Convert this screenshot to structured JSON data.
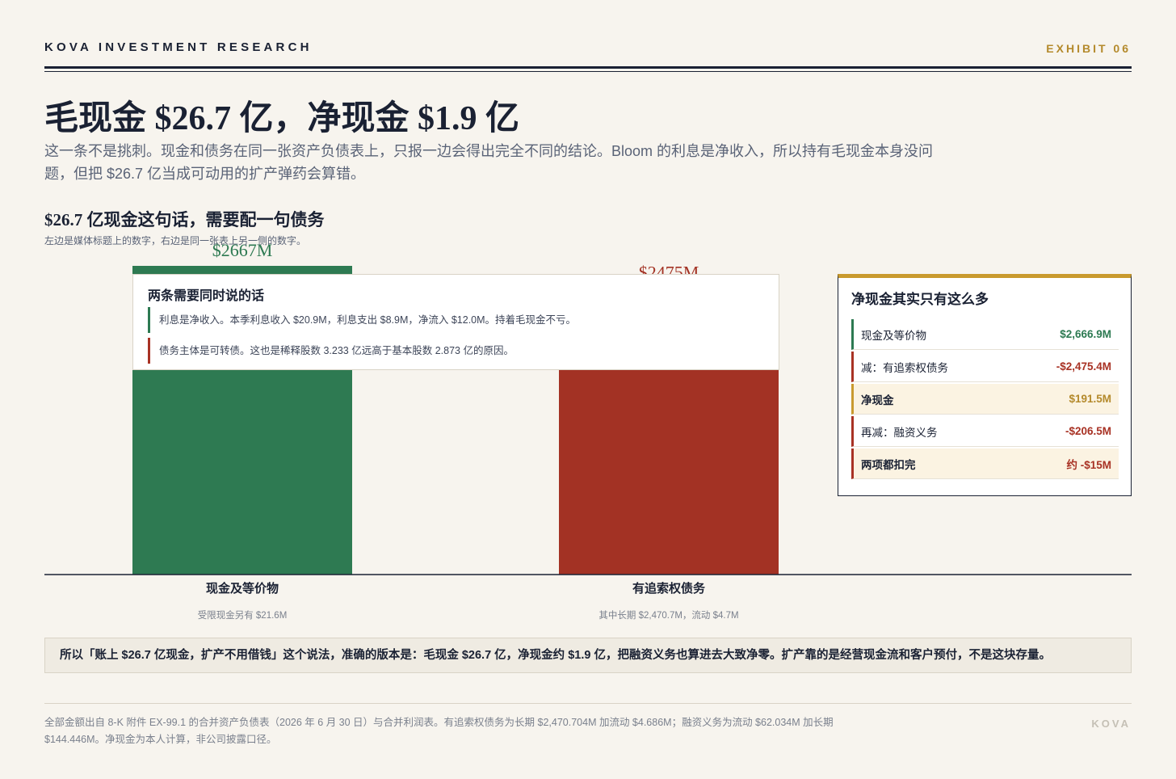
{
  "header": {
    "brand": "KOVA INVESTMENT RESEARCH",
    "exhibit": "EXHIBIT 06"
  },
  "headline": "毛现金 $26.7 亿，净现金 $1.9 亿",
  "subtitle": "这一条不是挑刺。现金和债务在同一张资产负债表上，只报一边会得出完全不同的结论。Bloom 的利息是净收入，所以持有毛现金本身没问题，但把 $26.7 亿当成可动用的扩产弹药会算错。",
  "chart_data": {
    "type": "bar",
    "title": "$26.7 亿现金这句话，需要配一句债务",
    "subtitle": "左边是媒体标题上的数字，右边是同一张表上另一侧的数字。",
    "categories": [
      "现金及等价物",
      "有追索权债务"
    ],
    "values": [
      2667,
      2475
    ],
    "value_labels": [
      "$2667M",
      "$2475M"
    ],
    "notes": [
      "受限现金另有 $21.6M",
      "其中长期 $2,470.7M，流动 $4.7M"
    ],
    "colors": [
      "#2e7a52",
      "#a33224"
    ],
    "ylim": [
      0,
      2667
    ],
    "grid": false
  },
  "callout": {
    "title": "两条需要同时说的话",
    "items": [
      "利息是净收入。本季利息收入 $20.9M，利息支出 $8.9M，净流入 $12.0M。持着毛现金不亏。",
      "债务主体是可转债。这也是稀释股数 3.233 亿远高于基本股数 2.873 亿的原因。"
    ]
  },
  "panel": {
    "title": "净现金其实只有这么多",
    "rows": [
      {
        "label": "现金及等价物",
        "value": "$2,666.9M"
      },
      {
        "label": "减：有追索权债务",
        "value": "-$2,475.4M"
      },
      {
        "label": "净现金",
        "value": "$191.5M"
      },
      {
        "label": "再减：融资义务",
        "value": "-$206.5M"
      },
      {
        "label": "两项都扣完",
        "value": "约 -$15M"
      }
    ]
  },
  "conclusion": "所以「账上 $26.7 亿现金，扩产不用借钱」这个说法，准确的版本是：毛现金 $26.7 亿，净现金约 $1.9 亿，把融资义务也算进去大致净零。扩产靠的是经营现金流和客户预付，不是这块存量。",
  "footnote": "全部金额出自 8-K 附件 EX-99.1 的合并资产负债表（2026 年 6 月 30 日）与合并利润表。有追索权债务为长期 $2,470.704M 加流动 $4.686M；融资义务为流动 $62.034M 加长期 $144.446M。净现金为本人计算，非公司披露口径。",
  "footer_brand": "KOVA"
}
